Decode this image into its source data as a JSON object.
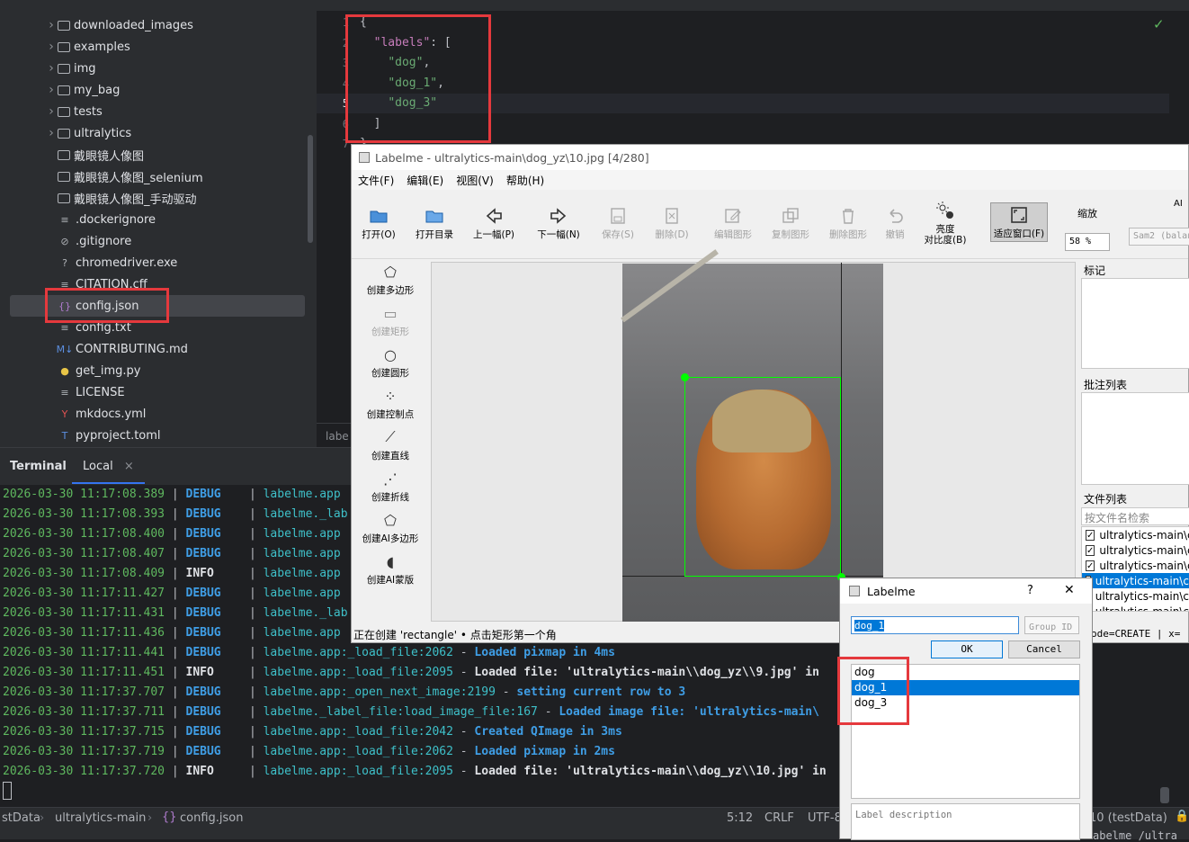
{
  "tree": [
    {
      "label": "downloaded_images",
      "icon": "folder-icon",
      "chev": true
    },
    {
      "label": "examples",
      "icon": "folder-icon",
      "chev": true
    },
    {
      "label": "img",
      "icon": "folder-icon",
      "chev": true
    },
    {
      "label": "my_bag",
      "icon": "folder-icon",
      "chev": true
    },
    {
      "label": "tests",
      "icon": "folder-icon",
      "chev": true
    },
    {
      "label": "ultralytics",
      "icon": "folder-icon",
      "chev": true
    },
    {
      "label": "戴眼镜人像图",
      "icon": "folder-icon",
      "chev": false
    },
    {
      "label": "戴眼镜人像图_selenium",
      "icon": "folder-icon",
      "chev": false
    },
    {
      "label": "戴眼镜人像图_手动驱动",
      "icon": "folder-icon",
      "chev": false
    },
    {
      "label": ".dockerignore",
      "icon": "text-file-icon",
      "chev": false
    },
    {
      "label": ".gitignore",
      "icon": "ignore-file-icon",
      "chev": false
    },
    {
      "label": "chromedriver.exe",
      "icon": "binary-file-icon",
      "chev": false
    },
    {
      "label": "CITATION.cff",
      "icon": "text-file-icon",
      "chev": false
    },
    {
      "label": "config.json",
      "icon": "json-file-icon",
      "chev": false
    },
    {
      "label": "config.txt",
      "icon": "text-file-icon",
      "chev": false
    },
    {
      "label": "CONTRIBUTING.md",
      "icon": "markdown-file-icon",
      "chev": false
    },
    {
      "label": "get_img.py",
      "icon": "python-file-icon",
      "chev": false
    },
    {
      "label": "LICENSE",
      "icon": "text-file-icon",
      "chev": false
    },
    {
      "label": "mkdocs.yml",
      "icon": "yaml-file-icon",
      "chev": false
    },
    {
      "label": "pyproject.toml",
      "icon": "toml-file-icon",
      "chev": false
    }
  ],
  "editor": {
    "gutter": [
      "1",
      "2",
      "3",
      "4",
      "5",
      "6",
      "7"
    ],
    "lines": {
      "l1": "{",
      "key": "\"labels\"",
      "colon": ": [",
      "v1": "\"dog\"",
      "c1": ",",
      "v2": "\"dog_1\"",
      "c2": ",",
      "v3": "\"dog_3\"",
      "l6": "]",
      "l7": "}"
    },
    "status_check": "✓",
    "bottom_tab": "labe"
  },
  "terminal": {
    "tabs": [
      "Terminal",
      "Local"
    ],
    "close": "×",
    "lines": [
      {
        "ts": "2026-03-30 11:17:08.389",
        "lvl": "DEBUG",
        "mod": "labelme.app",
        "fn": "",
        "msg": ""
      },
      {
        "ts": "2026-03-30 11:17:08.393",
        "lvl": "DEBUG",
        "mod": "labelme._lab",
        "fn": "",
        "msg": ""
      },
      {
        "ts": "2026-03-30 11:17:08.400",
        "lvl": "DEBUG",
        "mod": "labelme.app",
        "fn": "",
        "msg": ""
      },
      {
        "ts": "2026-03-30 11:17:08.407",
        "lvl": "DEBUG",
        "mod": "labelme.app",
        "fn": "",
        "msg": ""
      },
      {
        "ts": "2026-03-30 11:17:08.409",
        "lvl": "INFO",
        "mod": "labelme.app",
        "fn": "",
        "msg": ""
      },
      {
        "ts": "2026-03-30 11:17:11.427",
        "lvl": "DEBUG",
        "mod": "labelme.app",
        "fn": "",
        "msg": ""
      },
      {
        "ts": "2026-03-30 11:17:11.431",
        "lvl": "DEBUG",
        "mod": "labelme._lab",
        "fn": "",
        "msg": ""
      },
      {
        "ts": "2026-03-30 11:17:11.436",
        "lvl": "DEBUG",
        "mod": "labelme.app",
        "fn": "",
        "msg": ""
      },
      {
        "ts": "2026-03-30 11:17:11.441",
        "lvl": "DEBUG",
        "mod": "labelme.app",
        "fn": ":_load_file:2062",
        "msg": "Loaded pixmap in 4ms"
      },
      {
        "ts": "2026-03-30 11:17:11.451",
        "lvl": "INFO",
        "mod": "labelme.app",
        "fn": ":_load_file:2095",
        "msg": "Loaded file: 'ultralytics-main\\\\dog_yz\\\\9.jpg' in"
      },
      {
        "ts": "2026-03-30 11:17:37.707",
        "lvl": "DEBUG",
        "mod": "labelme.app",
        "fn": ":_open_next_image:2199",
        "msg": "setting current row to 3"
      },
      {
        "ts": "2026-03-30 11:17:37.711",
        "lvl": "DEBUG",
        "mod": "labelme._label_file",
        "fn": ":load_image_file:167",
        "msg": "Loaded image file: 'ultralytics-main\\"
      },
      {
        "ts": "2026-03-30 11:17:37.715",
        "lvl": "DEBUG",
        "mod": "labelme.app",
        "fn": ":_load_file:2042",
        "msg": "Created QImage in 3ms"
      },
      {
        "ts": "2026-03-30 11:17:37.719",
        "lvl": "DEBUG",
        "mod": "labelme.app",
        "fn": ":_load_file:2062",
        "msg": "Loaded pixmap in 2ms"
      },
      {
        "ts": "2026-03-30 11:17:37.720",
        "lvl": "INFO",
        "mod": "labelme.app",
        "fn": ":_load_file:2095",
        "msg": "Loaded file: 'ultralytics-main\\\\dog_yz\\\\10.jpg' in"
      }
    ],
    "cursor": ""
  },
  "statusbar": {
    "crumb1": "stData",
    "crumb2": "ultralytics-main",
    "crumb3": "config.json",
    "pos": "5:12",
    "eol": "CRLF",
    "enc": "UTF-8",
    "right": "10 (testData)"
  },
  "labelme": {
    "title": "Labelme - ultralytics-main\\dog_yz\\10.jpg [4/280]",
    "menu": [
      "文件(F)",
      "编辑(E)",
      "视图(V)",
      "帮助(H)"
    ],
    "toolbar": [
      {
        "label": "打开(O)",
        "icon": "open-folder-icon"
      },
      {
        "label": "打开目录",
        "icon": "open-dir-icon"
      },
      {
        "label": "上一幅(P)",
        "icon": "prev-arrow-icon"
      },
      {
        "label": "下一幅(N)",
        "icon": "next-arrow-icon"
      },
      {
        "label": "保存(S)",
        "icon": "save-icon"
      },
      {
        "label": "删除(D)",
        "icon": "delete-file-icon"
      },
      {
        "label": "编辑图形",
        "icon": "edit-shape-icon"
      },
      {
        "label": "复制图形",
        "icon": "copy-shape-icon"
      },
      {
        "label": "删除图形",
        "icon": "trash-icon"
      },
      {
        "label": "撤销",
        "icon": "undo-icon"
      },
      {
        "label": "亮度\n对比度(B)",
        "icon": "brightness-icon"
      },
      {
        "label": "适应窗口(F)",
        "icon": "fit-window-icon"
      }
    ],
    "zoom_label": "缩放",
    "zoom_value": "58 %",
    "ai_label": "AI",
    "ai_model": "Sam2 (balan",
    "tools": [
      {
        "label": "创建多边形",
        "icon": "polygon-icon"
      },
      {
        "label": "创建矩形",
        "icon": "rectangle-icon"
      },
      {
        "label": "创建圆形",
        "icon": "circle-icon"
      },
      {
        "label": "创建控制点",
        "icon": "points-icon"
      },
      {
        "label": "创建直线",
        "icon": "line-icon"
      },
      {
        "label": "创建折线",
        "icon": "polyline-icon"
      },
      {
        "label": "创建AI多边形",
        "icon": "ai-polygon-icon"
      },
      {
        "label": "创建AI蒙版",
        "icon": "ai-mask-icon"
      }
    ],
    "status": "正在创建 'rectangle' • 点击矩形第一个角",
    "status_right": "ode=CREATE | x=",
    "docks": {
      "flags": "标记",
      "labels": "批注列表",
      "files": "文件列表",
      "search_placeholder": "按文件名检索"
    },
    "files": [
      "ultralytics-main\\c",
      "ultralytics-main\\c",
      "ultralytics-main\\c",
      "ultralytics-main\\c",
      "ultralytics-main\\c",
      "ultralytics-main\\c"
    ],
    "colors": {
      "accent": "#0078d7",
      "box": "#00ff00"
    }
  },
  "dialog": {
    "title": "Labelme",
    "help": "?",
    "close": "✕",
    "input_value": "dog_1",
    "group_placeholder": "Group ID",
    "ok": "OK",
    "cancel": "Cancel",
    "items": [
      "dog",
      "dog_1",
      "dog_3"
    ],
    "desc_placeholder": "Label description"
  },
  "bottom_right": "abelme /ultra"
}
